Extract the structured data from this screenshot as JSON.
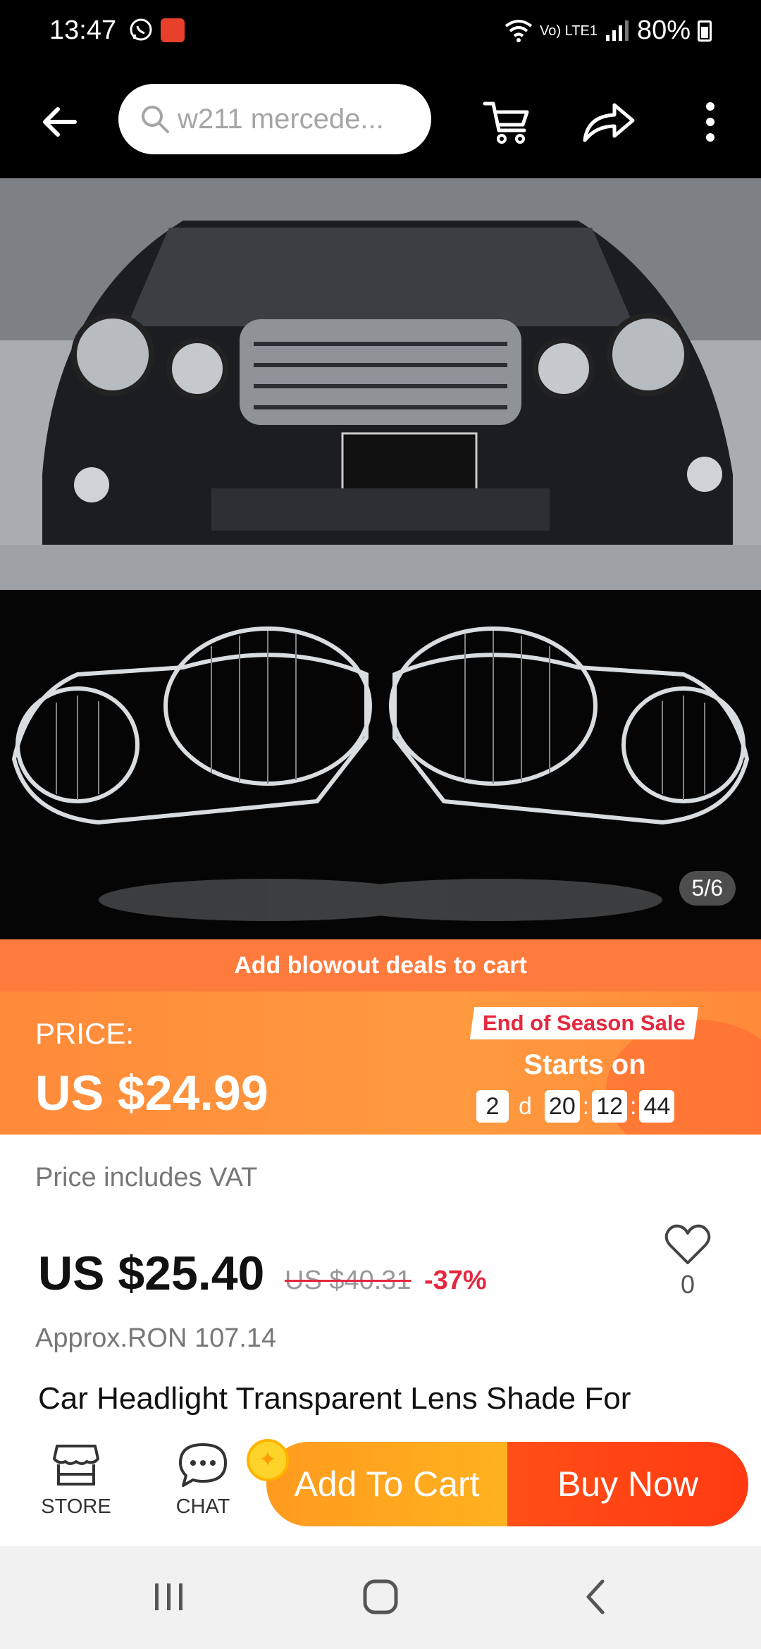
{
  "status_bar": {
    "time": "13:47",
    "network": "Vo) LTE1",
    "battery": "80%"
  },
  "header": {
    "search_text": "w211 mercede..."
  },
  "gallery": {
    "counter": "5/6"
  },
  "promo": {
    "banner": "Add blowout deals to cart",
    "price_label": "PRICE:",
    "price": "US $24.99",
    "sale_tag": "End of Season Sale",
    "starts_on": "Starts on",
    "countdown": {
      "days": "2",
      "day_unit": "d",
      "hours": "20",
      "minutes": "12",
      "seconds": "44"
    }
  },
  "product": {
    "vat_note": "Price includes VAT",
    "price": "US $25.40",
    "original_price": "US $40.31",
    "discount": "-37%",
    "wishlist_count": "0",
    "approx_price": "Approx.RON 107.14",
    "title": "Car Headlight Transparent Lens Shade For"
  },
  "action_bar": {
    "store_label": "STORE",
    "chat_label": "CHAT",
    "add_to_cart": "Add To Cart",
    "buy_now": "Buy Now"
  },
  "colors": {
    "promo_orange": "#ff7a3d",
    "price_orange": "#ff9a3e",
    "sale_red": "#e5283e",
    "add_cart_orange": "#ffb21f",
    "buy_now_red": "#ff3a12"
  }
}
